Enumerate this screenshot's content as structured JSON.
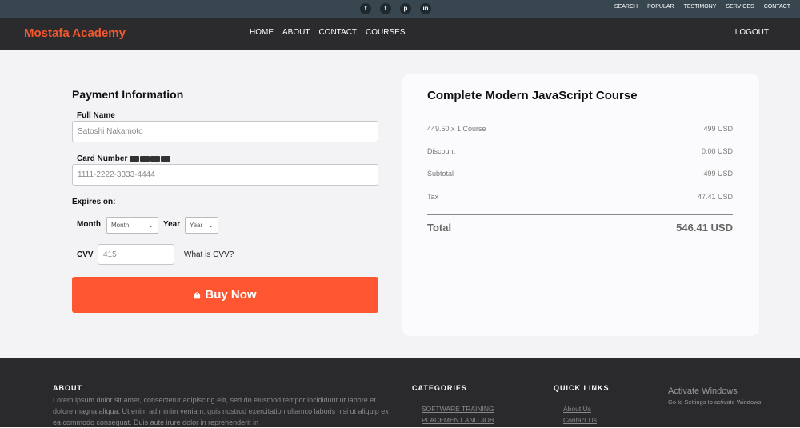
{
  "topbar": {
    "social": [
      "f",
      "t",
      "p",
      "in"
    ],
    "links": [
      "SEARCH",
      "POPULAR",
      "TESTIMONY",
      "SERVICES",
      "CONTACT"
    ]
  },
  "nav": {
    "brand": "Mostafa Academy",
    "menu": [
      "HOME",
      "ABOUT",
      "CONTACT",
      "COURSES"
    ],
    "logout": "LOGOUT"
  },
  "payment": {
    "title": "Payment Information",
    "full_name_label": "Full Name",
    "full_name_placeholder": "Satoshi Nakamoto",
    "card_label": "Card Number",
    "card_placeholder": "1111-2222-3333-4444",
    "expires_label": "Expires on:",
    "month_label": "Month",
    "month_value": "Month:",
    "year_label": "Year",
    "year_value": "Year",
    "cvv_label": "CVV",
    "cvv_placeholder": "415",
    "cvv_help": "What is CVV?",
    "buy": "Buy Now"
  },
  "summary": {
    "title": "Complete Modern JavaScript Course",
    "rows": [
      {
        "label": "449.50 x 1 Course",
        "value": "499 USD"
      },
      {
        "label": "Discount",
        "value": "0.00 USD"
      },
      {
        "label": "Subtotal",
        "value": "499 USD"
      },
      {
        "label": "Tax",
        "value": "47.41 USD"
      }
    ],
    "total_label": "Total",
    "total_value": "546.41 USD"
  },
  "footer": {
    "about_title": "ABOUT",
    "about_text": "Lorem ipsum dolor sit amet, consectetur adipiscing elit, sed do eiusmod tempor incididunt ut labore et dolore magna aliqua. Ut enim ad minim veniam, quis nostrud exercitation ullamco laboris nisi ut aliquip ex ea commodo consequat. Duis aute irure dolor in reprehenderit in",
    "categories_title": "CATEGORIES",
    "categories": [
      "SOFTWARE TRAINING",
      "PLACEMENT AND JOB"
    ],
    "quick_title": "QUICK LINKS",
    "quick": [
      "About Us",
      "Contact Us"
    ]
  },
  "watermark": {
    "title": "Activate Windows",
    "sub": "Go to Settings to activate Windows."
  }
}
